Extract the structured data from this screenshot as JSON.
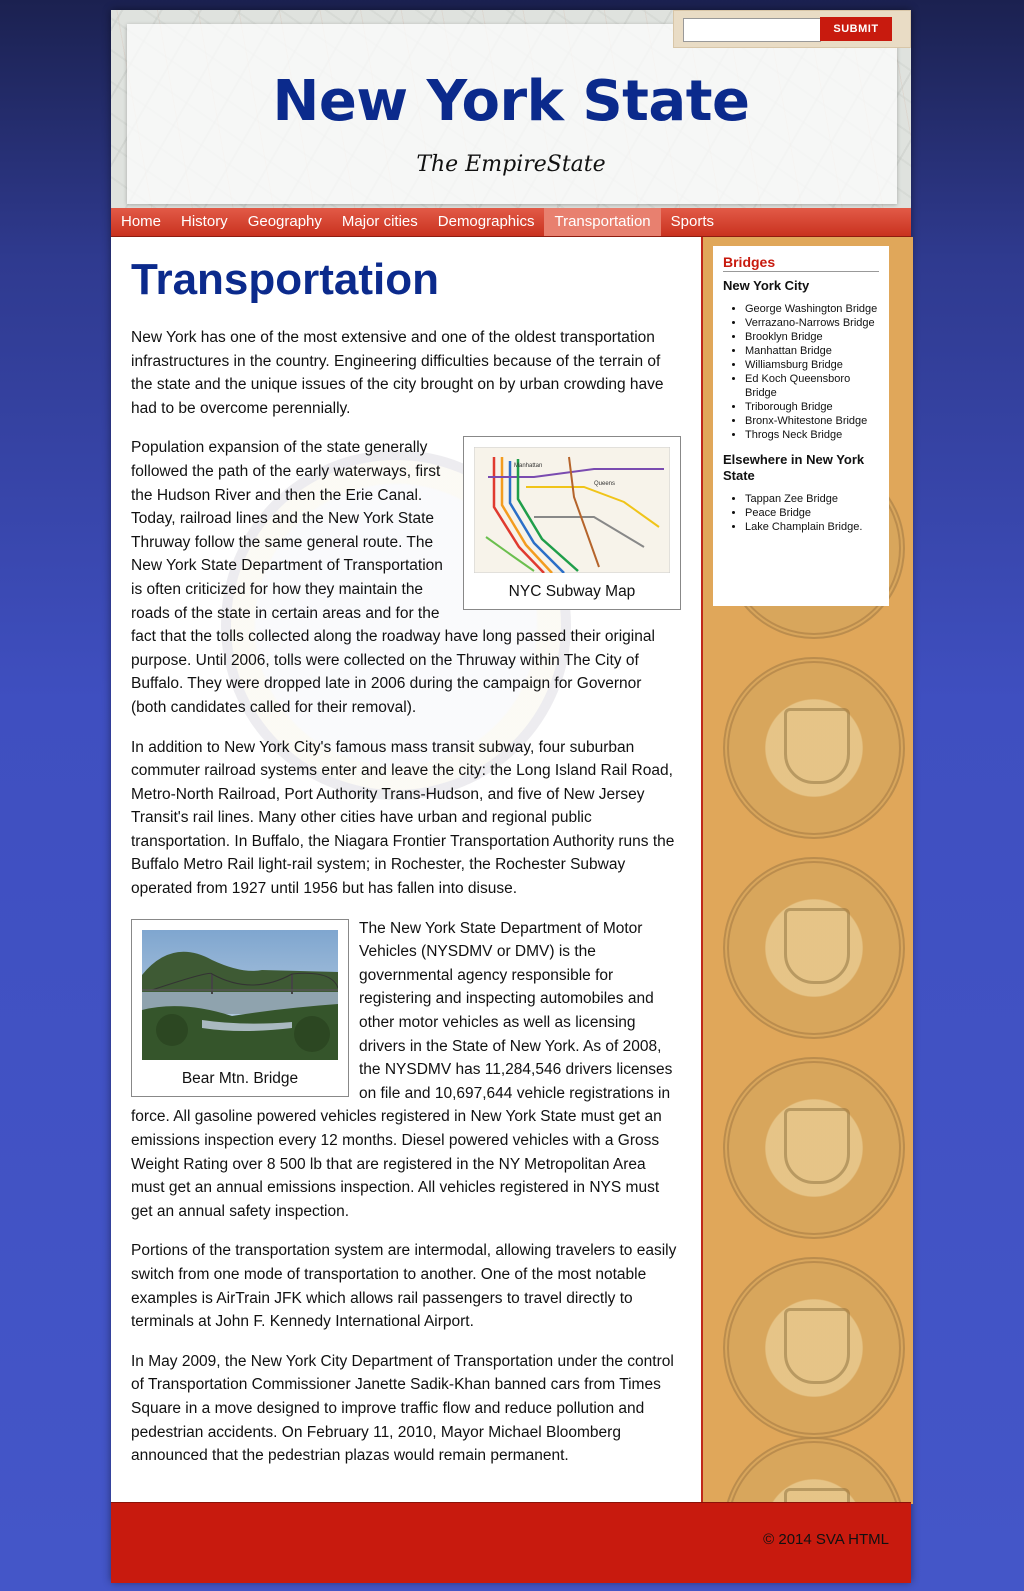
{
  "header": {
    "title": "New York State",
    "tagline": "The EmpireState",
    "search": {
      "value": "",
      "submit_label": "SUBMIT"
    }
  },
  "nav": {
    "items": [
      {
        "label": "Home",
        "active": false
      },
      {
        "label": "History",
        "active": false
      },
      {
        "label": "Geography",
        "active": false
      },
      {
        "label": "Major cities",
        "active": false
      },
      {
        "label": "Demographics",
        "active": false
      },
      {
        "label": "Transportation",
        "active": true
      },
      {
        "label": "Sports",
        "active": false
      }
    ]
  },
  "main": {
    "title": "Transportation",
    "paragraphs": [
      "New York has one of the most extensive and one of the oldest transportation infrastructures in the country. Engineering difficulties because of the terrain of the state and the unique issues of the city brought on by urban crowding have had to be overcome perennially.",
      "Population expansion of the state generally followed the path of the early waterways, first the Hudson River and then the Erie Canal. Today, railroad lines and the New York State Thruway follow the same general route. The New York State Department of Transportation is often criticized for how they maintain the roads of the state in certain areas and for the fact that the tolls collected along the roadway have long passed their original purpose. Until 2006, tolls were collected on the Thruway within The City of Buffalo. They were dropped late in 2006 during the campaign for Governor (both candidates called for their removal).",
      "In addition to New York City's famous mass transit subway, four suburban commuter railroad systems enter and leave the city: the Long Island Rail Road, Metro-North Railroad, Port Authority Trans-Hudson, and five of New Jersey Transit's rail lines. Many other cities have urban and regional public transportation. In Buffalo, the Niagara Frontier Transportation Authority runs the Buffalo Metro Rail light-rail system; in Rochester, the Rochester Subway operated from 1927 until 1956 but has fallen into disuse.",
      "The New York State Department of Motor Vehicles (NYSDMV or DMV) is the governmental agency responsible for registering and inspecting automobiles and other motor vehicles as well as licensing drivers in the State of New York. As of 2008, the NYSDMV has 11,284,546 drivers licenses on file and 10,697,644 vehicle registrations in force. All gasoline powered vehicles registered in New York State must get an emissions inspection every 12 months. Diesel powered vehicles with a Gross Weight Rating over 8 500 lb that are registered in the NY Metropolitan Area must get an annual emissions inspection. All vehicles registered in NYS must get an annual safety inspection.",
      "Portions of the transportation system are intermodal, allowing travelers to easily switch from one mode of transportation to another. One of the most notable examples is AirTrain JFK which allows rail passengers to travel directly to terminals at John F. Kennedy International Airport.",
      "In May 2009, the New York City Department of Transportation under the control of Transportation Commissioner Janette Sadik-Khan banned cars from Times Square in a move designed to improve traffic flow and reduce pollution and pedestrian accidents. On February 11, 2010, Mayor Michael Bloomberg announced that the pedestrian plazas would remain permanent."
    ],
    "figures": {
      "subway": {
        "caption": "NYC Subway Map",
        "map_labels": [
          "Manhattan",
          "Queens"
        ]
      },
      "bridge": {
        "caption": "Bear Mtn. Bridge"
      }
    }
  },
  "sidebar": {
    "heading": "Bridges",
    "groups": [
      {
        "title": "New York City",
        "items": [
          "George Washington Bridge",
          "Verrazano-Narrows Bridge",
          "Brooklyn Bridge",
          "Manhattan Bridge",
          "Williamsburg Bridge",
          "Ed Koch Queensboro Bridge",
          "Triborough Bridge",
          "Bronx-Whitestone Bridge",
          "Throgs Neck Bridge"
        ]
      },
      {
        "title": "Elsewhere in New York State",
        "items": [
          "Tappan Zee Bridge",
          "Peace Bridge",
          "Lake Champlain Bridge."
        ]
      }
    ]
  },
  "footer": {
    "text": "© 2014 SVA HTML"
  },
  "colors": {
    "title_blue": "#0b2a8c",
    "accent_red": "#c81a0e",
    "sidebar_gold": "#e0a75a"
  }
}
